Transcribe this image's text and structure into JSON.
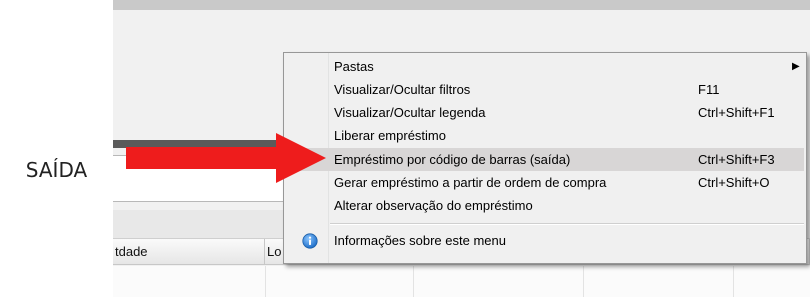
{
  "side_label": "SAÍDA",
  "grid": {
    "columns": [
      "tdade",
      "Lo"
    ]
  },
  "context_menu": {
    "items": [
      {
        "label": "Pastas",
        "shortcut": "",
        "submenu": true
      },
      {
        "label": "Visualizar/Ocultar filtros",
        "shortcut": "F11"
      },
      {
        "label": "Visualizar/Ocultar legenda",
        "shortcut": "Ctrl+Shift+F1"
      },
      {
        "label": "Liberar empréstimo",
        "shortcut": ""
      },
      {
        "label": "Empréstimo por código de barras (saída)",
        "shortcut": "Ctrl+Shift+F3",
        "highlighted": true
      },
      {
        "label": "Gerar empréstimo a partir de ordem de compra",
        "shortcut": "Ctrl+Shift+O"
      },
      {
        "label": "Alterar observação do empréstimo",
        "shortcut": ""
      }
    ],
    "info_item": {
      "label": "Informações sobre este menu",
      "icon": "info-icon"
    }
  },
  "colors": {
    "arrow": "#ee1c1c",
    "highlight": "#d8d6d6",
    "info_icon": "#2a7fd6"
  }
}
